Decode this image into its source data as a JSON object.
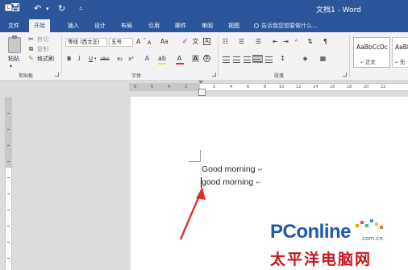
{
  "titlebar": {
    "save_icon": "save-icon",
    "undo_icon": "undo-icon",
    "redo_icon": "redo-icon",
    "customize_icon": "dropdown-icon",
    "doc_title": "文档1 - Word",
    "color": "#2b579a"
  },
  "tabs": [
    {
      "label": "文件"
    },
    {
      "label": "开始"
    },
    {
      "label": "插入"
    },
    {
      "label": "设计"
    },
    {
      "label": "布局"
    },
    {
      "label": "引用"
    },
    {
      "label": "邮件"
    },
    {
      "label": "审阅"
    },
    {
      "label": "视图"
    }
  ],
  "active_tab": "开始",
  "tellme": {
    "text": "告诉我您想要做什么..."
  },
  "clipboard": {
    "paste": "粘贴",
    "cut": "剪切",
    "copy": "复制",
    "format_painter": "格式刷",
    "group_label": "剪贴板"
  },
  "font": {
    "name": "等线 (西文正)",
    "size": "五号",
    "grow": "A",
    "shrink": "A",
    "case": "Aa",
    "bold": "B",
    "italic": "I",
    "underline": "U",
    "strike": "abc",
    "subscript": "x₂",
    "superscript": "x²",
    "group_label": "字体"
  },
  "paragraph": {
    "group_label": "段落"
  },
  "styles": [
    {
      "sample": "AaBbCcDc",
      "name": "正文"
    },
    {
      "sample": "AaBb",
      "name": "无"
    }
  ],
  "ruler": {
    "corner": "L",
    "ticks": [
      "8",
      "6",
      "4",
      "2",
      "2",
      "4",
      "6",
      "8",
      "10",
      "12",
      "14",
      "16",
      "18",
      "20",
      "22"
    ]
  },
  "document": {
    "line1": "Good morning",
    "line2": "good morning",
    "para_mark": "↵"
  },
  "watermark": {
    "brand": "PConline",
    "domain": ".com.cn",
    "cn": "太平洋电脑网",
    "brand_color": "#1e5aa8",
    "cn_color": "#c8161d"
  },
  "annotation": {
    "color": "#e0302e"
  }
}
